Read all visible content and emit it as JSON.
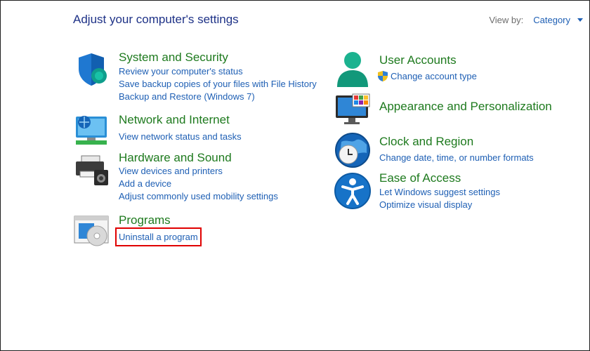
{
  "header": {
    "title": "Adjust your computer's settings",
    "view_by_label": "View by:",
    "view_by_value": "Category"
  },
  "left": {
    "system_security": {
      "title": "System and Security",
      "links": [
        "Review your computer's status",
        "Save backup copies of your files with File History",
        "Backup and Restore (Windows 7)"
      ]
    },
    "network": {
      "title": "Network and Internet",
      "links": [
        "View network status and tasks"
      ]
    },
    "hardware": {
      "title": "Hardware and Sound",
      "links": [
        "View devices and printers",
        "Add a device",
        "Adjust commonly used mobility settings"
      ]
    },
    "programs": {
      "title": "Programs",
      "links": [
        "Uninstall a program"
      ]
    }
  },
  "right": {
    "user_accounts": {
      "title": "User Accounts",
      "links": [
        "Change account type"
      ]
    },
    "appearance": {
      "title": "Appearance and Personalization"
    },
    "clock": {
      "title": "Clock and Region",
      "links": [
        "Change date, time, or number formats"
      ]
    },
    "ease": {
      "title": "Ease of Access",
      "links": [
        "Let Windows suggest settings",
        "Optimize visual display"
      ]
    }
  },
  "colors": {
    "category_title": "#1e7a1e",
    "link": "#1e5fb4",
    "page_title": "#1e3287",
    "highlight": "#e00000"
  },
  "icons": {
    "system_security": "shield-icon",
    "network": "network-monitor-icon",
    "hardware": "printer-speaker-icon",
    "programs": "programs-disc-icon",
    "user_accounts": "user-icon",
    "appearance": "monitor-palette-icon",
    "clock": "clock-globe-icon",
    "ease": "ease-of-access-icon",
    "uac": "uac-shield-icon"
  }
}
